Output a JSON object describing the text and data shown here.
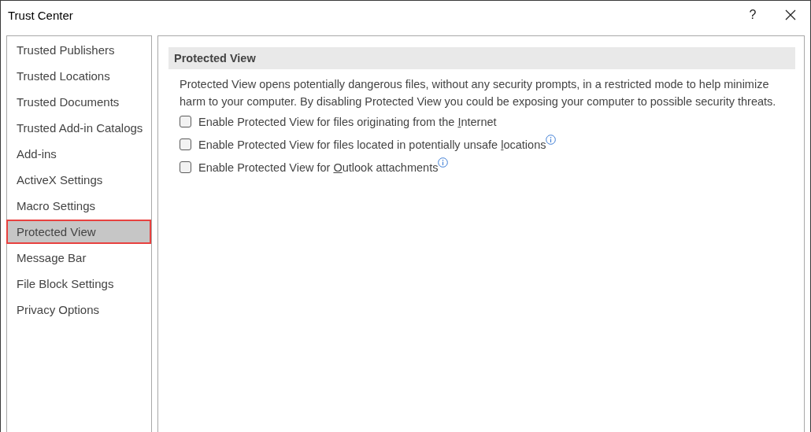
{
  "window": {
    "title": "Trust Center",
    "help": "?"
  },
  "sidebar": {
    "items": [
      {
        "label": "Trusted Publishers",
        "selected": false
      },
      {
        "label": "Trusted Locations",
        "selected": false
      },
      {
        "label": "Trusted Documents",
        "selected": false
      },
      {
        "label": "Trusted Add-in Catalogs",
        "selected": false
      },
      {
        "label": "Add-ins",
        "selected": false
      },
      {
        "label": "ActiveX Settings",
        "selected": false
      },
      {
        "label": "Macro Settings",
        "selected": false
      },
      {
        "label": "Protected View",
        "selected": true
      },
      {
        "label": "Message Bar",
        "selected": false
      },
      {
        "label": "File Block Settings",
        "selected": false
      },
      {
        "label": "Privacy Options",
        "selected": false
      }
    ]
  },
  "section": {
    "heading": "Protected View",
    "description": "Protected View opens potentially dangerous files, without any security prompts, in a restricted mode to help minimize harm to your computer. By disabling Protected View you could be exposing your computer to possible security threats.",
    "options": [
      {
        "text_before": "Enable Protected View for files originating from the ",
        "access_key": "I",
        "text_after": "nternet",
        "checked": false,
        "info": false
      },
      {
        "text_before": "Enable Protected View for files located in potentially unsafe ",
        "access_key": "l",
        "text_after": "ocations",
        "checked": false,
        "info": true
      },
      {
        "text_before": "Enable Protected View for ",
        "access_key": "O",
        "text_after": "utlook attachments",
        "checked": false,
        "info": true
      }
    ]
  }
}
